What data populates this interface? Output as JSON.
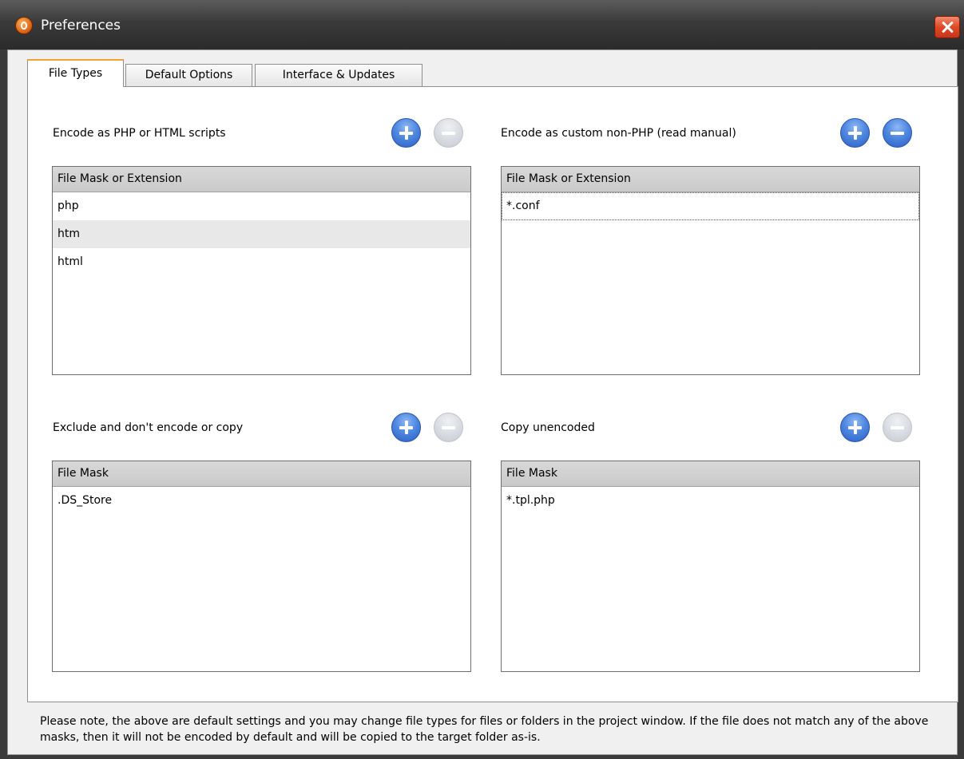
{
  "window": {
    "title": "Preferences",
    "app_icon": "app-logo-icon",
    "close_icon": "close-icon"
  },
  "tabs": [
    {
      "label": "File Types",
      "active": true
    },
    {
      "label": "Default Options",
      "active": false
    },
    {
      "label": "Interface & Updates",
      "active": false
    }
  ],
  "sections": {
    "encode_php": {
      "label": "Encode as PHP or HTML scripts",
      "add_enabled": true,
      "remove_enabled": false,
      "column_header": "File Mask or Extension",
      "rows": [
        "php",
        "htm",
        "html"
      ]
    },
    "encode_custom": {
      "label": "Encode as custom non-PHP (read manual)",
      "add_enabled": true,
      "remove_enabled": true,
      "column_header": "File Mask or Extension",
      "rows": [
        "*.conf"
      ]
    },
    "exclude": {
      "label": "Exclude and don't encode or copy",
      "add_enabled": true,
      "remove_enabled": false,
      "column_header": "File Mask",
      "rows": [
        ".DS_Store"
      ]
    },
    "copy_unencoded": {
      "label": "Copy unencoded",
      "add_enabled": true,
      "remove_enabled": false,
      "column_header": "File Mask",
      "rows": [
        "*.tpl.php"
      ]
    }
  },
  "note": "Please note, the above are default settings and you may change file types for files or folders in the project window. If the file does not match any of the above masks, then it will not be encoded by default and will be copied to the target folder as-is.",
  "colors": {
    "titlebar": "#2b2b2b",
    "close_button": "#de4a24",
    "active_tab_accent": "#f3a22d",
    "add_button": "#4f87e0",
    "disabled_button": "#d7dbe1"
  }
}
